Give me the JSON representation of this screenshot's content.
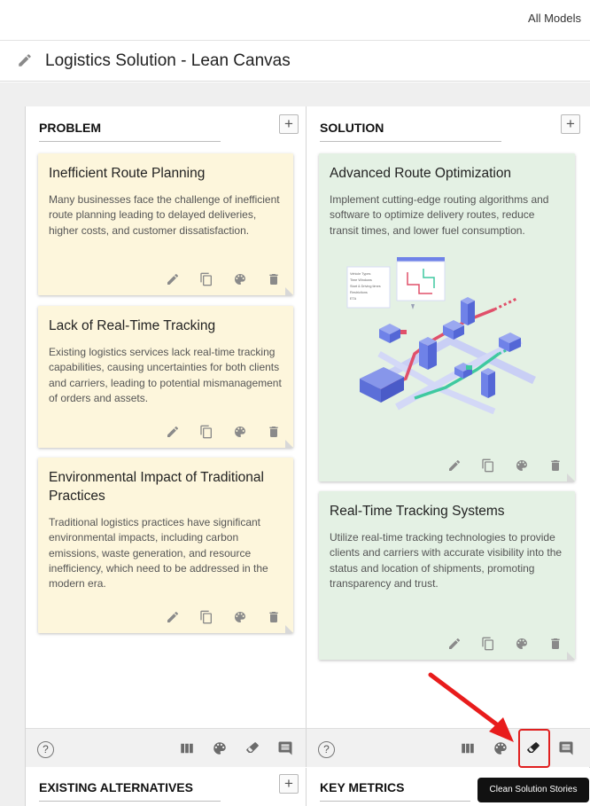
{
  "topbar": {
    "all_models": "All Models"
  },
  "page": {
    "title": "Logistics Solution - Lean Canvas"
  },
  "columns": [
    {
      "header": "PROBLEM",
      "add_label": "+",
      "cards": [
        {
          "title": "Inefficient Route Planning",
          "body": "Many businesses face the challenge of inefficient route planning leading to delayed deliveries, higher costs, and customer dissatisfaction."
        },
        {
          "title": "Lack of Real-Time Tracking",
          "body": "Existing logistics services lack real-time tracking capabilities, causing uncertainties for both clients and carriers, leading to potential mismanagement of orders and assets."
        },
        {
          "title": "Environmental Impact of Traditional Practices",
          "body": "Traditional logistics practices have significant environmental impacts, including carbon emissions, waste generation, and resource inefficiency, which need to be addressed in the modern era."
        }
      ]
    },
    {
      "header": "SOLUTION",
      "add_label": "+",
      "cards": [
        {
          "title": "Advanced Route Optimization",
          "body": "Implement cutting-edge routing algorithms and software to optimize delivery routes, reduce transit times, and lower fuel consumption."
        },
        {
          "title": "Real-Time Tracking Systems",
          "body": "Utilize real-time tracking technologies to provide clients and carriers with accurate visibility into the status and location of shipments, promoting transparency and trust."
        }
      ]
    }
  ],
  "bottom_columns": [
    {
      "header": "EXISTING ALTERNATIVES",
      "add_label": "+"
    },
    {
      "header": "KEY METRICS"
    }
  ],
  "footer": {
    "help_label": "?"
  },
  "tooltip": {
    "text": "Clean Solution Stories"
  },
  "illustration_popup": {
    "items": [
      "Vehicle Types",
      "Time Windows",
      "Start & Driving times",
      "Restrictions",
      "ETA"
    ]
  },
  "colors": {
    "card_yellow": "#fdf6dc",
    "card_green": "#e4f1e4",
    "highlight": "#e02020",
    "tooltip_bg": "#111111",
    "route_red": "#e0506a",
    "route_green": "#3fc9a0",
    "building_blue": "#6f82e8"
  },
  "icons": [
    "pencil-icon",
    "copy-icon",
    "palette-icon",
    "trash-icon",
    "columns-icon",
    "eraser-icon",
    "comment-icon",
    "help-icon"
  ]
}
